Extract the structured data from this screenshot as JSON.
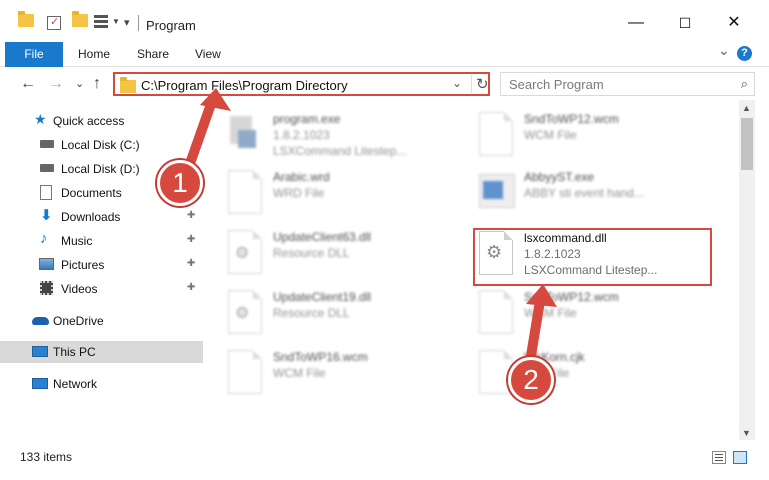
{
  "window": {
    "title": "Program",
    "minimize": "—",
    "maximize": "☐",
    "close": "✕"
  },
  "ribbon": {
    "tabs": [
      "File",
      "Home",
      "Share",
      "View"
    ],
    "expand_glyph": "⌄",
    "help_glyph": "?"
  },
  "nav": {
    "back": "←",
    "forward": "→",
    "recent": "⌄",
    "up": "↑"
  },
  "address": {
    "path": "C:\\Program Files\\Program Directory",
    "chevron": "⌄",
    "refresh": "↻"
  },
  "search": {
    "placeholder": "Search Program",
    "icon": "⌕"
  },
  "sidebar": {
    "items": [
      {
        "label": "Quick access",
        "icon": "star-icon",
        "pinned": false
      },
      {
        "label": "Local Disk (C:)",
        "icon": "drive-icon",
        "pinned": false
      },
      {
        "label": "Local Disk (D:)",
        "icon": "drive-icon",
        "pinned": false
      },
      {
        "label": "Documents",
        "icon": "documents-icon",
        "pinned": false
      },
      {
        "label": "Downloads",
        "icon": "download-icon",
        "pinned": true
      },
      {
        "label": "Music",
        "icon": "music-icon",
        "pinned": true
      },
      {
        "label": "Pictures",
        "icon": "pictures-icon",
        "pinned": true
      },
      {
        "label": "Videos",
        "icon": "videos-icon",
        "pinned": true
      },
      {
        "label": "OneDrive",
        "icon": "cloud-icon",
        "pinned": false
      },
      {
        "label": "This PC",
        "icon": "computer-icon",
        "pinned": false,
        "selected": true
      },
      {
        "label": "Network",
        "icon": "network-icon",
        "pinned": false
      }
    ],
    "pin_glyph": "📌"
  },
  "files": [
    {
      "name": "program.exe",
      "line2": "1.8.2.1023",
      "line3": "LSXCommand Litestep...",
      "icon": "exe-icon",
      "focus": false
    },
    {
      "name": "SndToWP12.wcm",
      "line2": "WCM File",
      "line3": "",
      "icon": "file-icon",
      "focus": false
    },
    {
      "name": "Arabic.wrd",
      "line2": "WRD File",
      "line3": "",
      "icon": "file-icon",
      "focus": false
    },
    {
      "name": "AbbyyST.exe",
      "line2": "ABBY sti event hand...",
      "line3": "",
      "icon": "app-window-icon",
      "focus": false
    },
    {
      "name": "UpdateClient63.dll",
      "line2": "Resource DLL",
      "line3": "",
      "icon": "dll-icon",
      "focus": false
    },
    {
      "name": "lsxcommand.dll",
      "line2": "1.8.2.1023",
      "line3": "LSXCommand Litestep...",
      "icon": "dll-icon",
      "focus": true
    },
    {
      "name": "UpdateClient19.dll",
      "line2": "Resource DLL",
      "line3": "",
      "icon": "dll-icon",
      "focus": false
    },
    {
      "name": "SndToWP12.wcm",
      "line2": "WCM File",
      "line3": "",
      "icon": "file-icon",
      "focus": false
    },
    {
      "name": "SndToWP16.wcm",
      "line2": "WCM File",
      "line3": "",
      "icon": "file-icon",
      "focus": false
    },
    {
      "name": "WkKorn.cjk",
      "line2": "CJK File",
      "line3": "",
      "icon": "file-icon",
      "focus": false
    }
  ],
  "status": {
    "count": "133 items"
  },
  "annotations": {
    "step1": "1",
    "step2": "2",
    "accent": "#d6493f"
  },
  "colors": {
    "file_tab": "#1979ca",
    "selected_nav": "#d9d9d9"
  }
}
